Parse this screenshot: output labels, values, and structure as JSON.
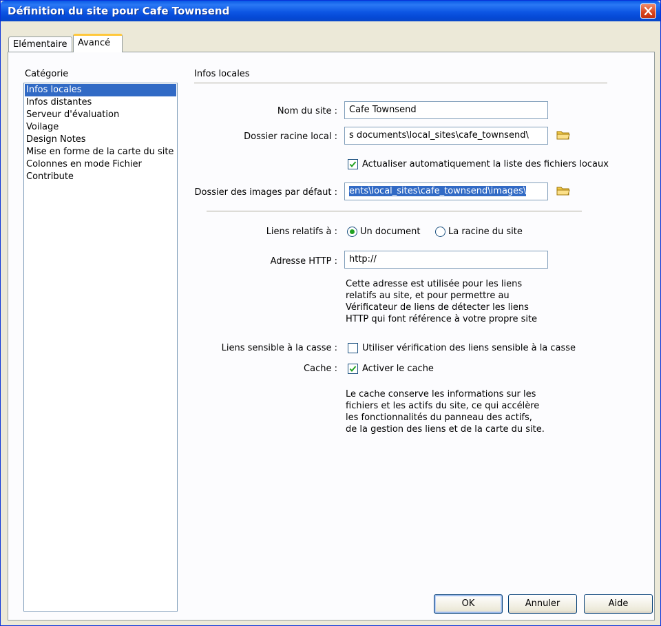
{
  "window": {
    "title": "Définition du site pour Cafe Townsend"
  },
  "tabs": [
    {
      "label": "Elémentaire",
      "active": false
    },
    {
      "label": "Avancé",
      "active": true
    }
  ],
  "category": {
    "label": "Catégorie",
    "items": [
      "Infos locales",
      "Infos distantes",
      "Serveur d'évaluation",
      "Voilage",
      "Design Notes",
      "Mise en forme de la carte du site",
      "Colonnes en mode Fichier",
      "Contribute"
    ],
    "selected": "Infos locales"
  },
  "section": {
    "title": "Infos locales"
  },
  "form": {
    "site_name_label": "Nom du site :",
    "site_name_value": "Cafe Townsend",
    "local_root_label": "Dossier racine local :",
    "local_root_value": "s documents\\local_sites\\cafe_townsend\\",
    "auto_refresh_label": "Actualiser automatiquement la liste des fichiers locaux",
    "auto_refresh_checked": true,
    "default_images_label": "Dossier des images par défaut :",
    "default_images_value": "ents\\local_sites\\cafe_townsend\\images\\",
    "relative_links_label": "Liens relatifs à :",
    "relative_options": [
      "Un document",
      "La racine du site"
    ],
    "relative_selected": "Un document",
    "http_label": "Adresse HTTP :",
    "http_value": "http://",
    "http_help": [
      "Cette adresse est utilisée pour les liens",
      "relatifs au site, et pour permettre au",
      "Vérificateur de liens de détecter les liens",
      "HTTP qui font référence à votre propre site"
    ],
    "case_label": "Liens sensible à la casse :",
    "case_option": "Utiliser vérification des liens sensible à la casse",
    "case_checked": false,
    "cache_label": "Cache :",
    "cache_option": "Activer le cache",
    "cache_checked": true,
    "cache_help": [
      "Le cache conserve les informations sur les",
      "fichiers et les actifs du site, ce qui accélère",
      "les fonctionnalités du panneau des actifs,",
      "de la gestion des liens et de la carte du site."
    ]
  },
  "buttons": {
    "ok": "OK",
    "cancel": "Annuler",
    "help": "Aide"
  },
  "icons": [
    "close-icon",
    "folder-icon",
    "checkmark-icon"
  ]
}
